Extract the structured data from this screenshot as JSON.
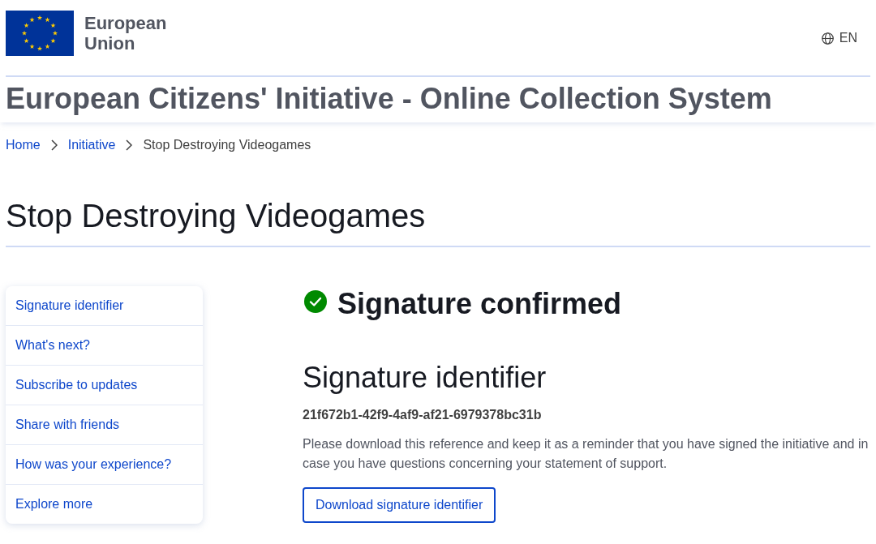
{
  "header": {
    "logo_text": "European Union",
    "language": {
      "label": "EN"
    },
    "site_title": "European Citizens' Initiative - Online Collection System"
  },
  "breadcrumb": [
    {
      "label": "Home",
      "kind": "link"
    },
    {
      "label": "Initiative",
      "kind": "link"
    },
    {
      "label": "Stop Destroying Videogames",
      "kind": "current"
    }
  ],
  "page_title": "Stop Destroying Videogames",
  "sidebar": {
    "items": [
      {
        "label": "Signature identifier"
      },
      {
        "label": "What's next?"
      },
      {
        "label": "Subscribe to updates"
      },
      {
        "label": "Share with friends"
      },
      {
        "label": "How was your experience?"
      },
      {
        "label": "Explore more"
      }
    ]
  },
  "confirmation": {
    "title": "Signature confirmed"
  },
  "identifier_section": {
    "heading": "Signature identifier",
    "identifier": "21f672b1-42f9-4af9-af21-6979378bc31b",
    "description": "Please download this reference and keep it as a reminder that you have signed the initiative and in case you have questions concerning your statement of support.",
    "button": "Download signature identifier"
  }
}
